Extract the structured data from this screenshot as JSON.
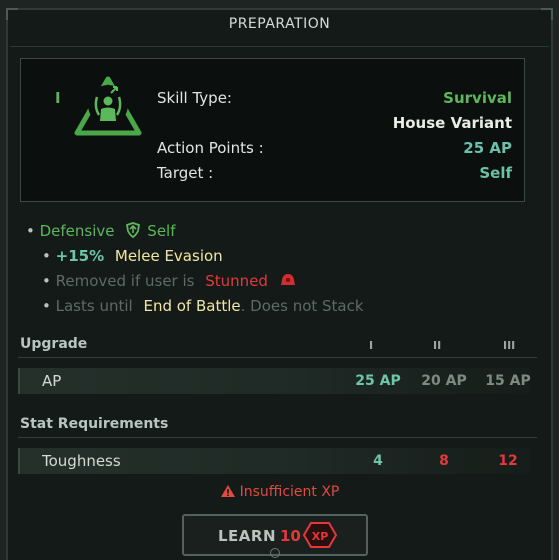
{
  "window": {
    "title": "PREPARATION"
  },
  "skill": {
    "tier_mark": "I",
    "icon": "survival-skill-icon",
    "rows": [
      {
        "label": "Skill Type:",
        "value": "Survival"
      },
      {
        "label": "",
        "value": "House Variant"
      },
      {
        "label": "Action Points :",
        "value": "25 AP"
      },
      {
        "label": "Target :",
        "value": "Self"
      }
    ]
  },
  "effects": {
    "category": "Defensive",
    "target": "Self",
    "bonus_value": "+15%",
    "bonus_label": "Melee Evasion",
    "removed_prefix": "Removed if user is",
    "removed_status": "Stunned",
    "lasts_prefix": "Lasts until",
    "lasts_value": "End of Battle",
    "lasts_suffix": ". Does not Stack"
  },
  "upgrade": {
    "title": "Upgrade",
    "tiers": [
      "I",
      "II",
      "III"
    ],
    "row_label": "AP",
    "values": [
      "25 AP",
      "20 AP",
      "15 AP"
    ]
  },
  "requirements": {
    "title": "Stat Requirements",
    "row_label": "Toughness",
    "values": [
      "4",
      "8",
      "12"
    ]
  },
  "warning": {
    "text": "Insufficient XP"
  },
  "learn": {
    "label": "LEARN",
    "cost": "10",
    "currency": "XP"
  },
  "colors": {
    "accent_green": "#5db75b",
    "teal": "#69c2a9",
    "red": "#e23a3a",
    "yellow": "#f2e7a6"
  }
}
